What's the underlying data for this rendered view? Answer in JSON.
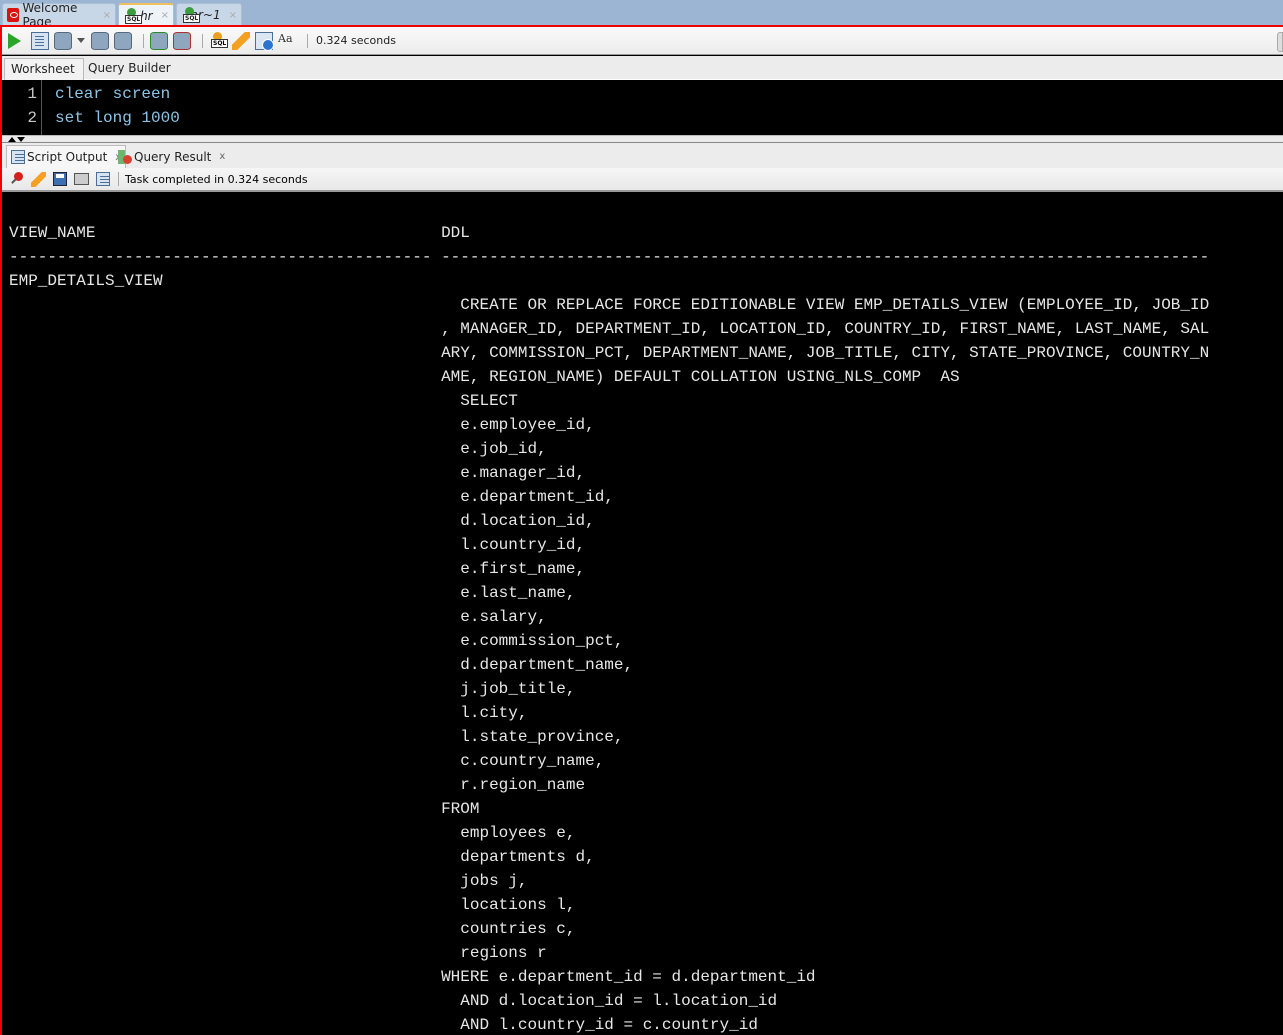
{
  "tabs": [
    {
      "label": "Welcome Page",
      "icon": "oracle-icon",
      "active": false,
      "italic": false
    },
    {
      "label": "hr",
      "icon": "sql-worksheet-icon",
      "active": true,
      "italic": true
    },
    {
      "label": "hr~1",
      "icon": "sql-worksheet-icon",
      "active": false,
      "italic": true
    }
  ],
  "tab_close": "×",
  "toolbar": {
    "icons": [
      "run-statement-icon",
      "run-script-icon",
      "autotrace-icon",
      "dropdown-icon",
      "explain-plan-icon",
      "sql-tuning-icon",
      "commit-icon",
      "rollback-icon",
      "unshared-sql-icon",
      "clear-icon",
      "sql-history-icon",
      "to-upper-lower-icon"
    ],
    "elapsed": "0.324 seconds"
  },
  "subtabs": {
    "worksheet": "Worksheet",
    "query_builder": "Query Builder"
  },
  "editor": {
    "lines": [
      {
        "num": "1",
        "text": "clear screen"
      },
      {
        "num": "2",
        "text": "set long 1000"
      }
    ]
  },
  "output_tabs": [
    {
      "label": "Script Output",
      "close": "x",
      "active": true
    },
    {
      "label": "Query Result",
      "close": "x",
      "active": false
    }
  ],
  "output_toolbar": {
    "status": "Task completed in 0.324 seconds"
  },
  "output": {
    "lines": [
      "",
      "VIEW_NAME                                    DDL",
      "-------------------------------------------- --------------------------------------------------------------------------------",
      "EMP_DETAILS_VIEW",
      "                                               CREATE OR REPLACE FORCE EDITIONABLE VIEW EMP_DETAILS_VIEW (EMPLOYEE_ID, JOB_ID",
      "                                             , MANAGER_ID, DEPARTMENT_ID, LOCATION_ID, COUNTRY_ID, FIRST_NAME, LAST_NAME, SAL",
      "                                             ARY, COMMISSION_PCT, DEPARTMENT_NAME, JOB_TITLE, CITY, STATE_PROVINCE, COUNTRY_N",
      "                                             AME, REGION_NAME) DEFAULT COLLATION USING_NLS_COMP  AS",
      "                                               SELECT",
      "                                               e.employee_id,",
      "                                               e.job_id,",
      "                                               e.manager_id,",
      "                                               e.department_id,",
      "                                               d.location_id,",
      "                                               l.country_id,",
      "                                               e.first_name,",
      "                                               e.last_name,",
      "                                               e.salary,",
      "                                               e.commission_pct,",
      "                                               d.department_name,",
      "                                               j.job_title,",
      "                                               l.city,",
      "                                               l.state_province,",
      "                                               c.country_name,",
      "                                               r.region_name",
      "                                             FROM",
      "                                               employees e,",
      "                                               departments d,",
      "                                               jobs j,",
      "                                               locations l,",
      "                                               countries c,",
      "                                               regions r",
      "                                             WHERE e.department_id = d.department_id",
      "                                               AND d.location_id = l.location_id",
      "                                               AND l.country_id = c.country_id"
    ]
  }
}
